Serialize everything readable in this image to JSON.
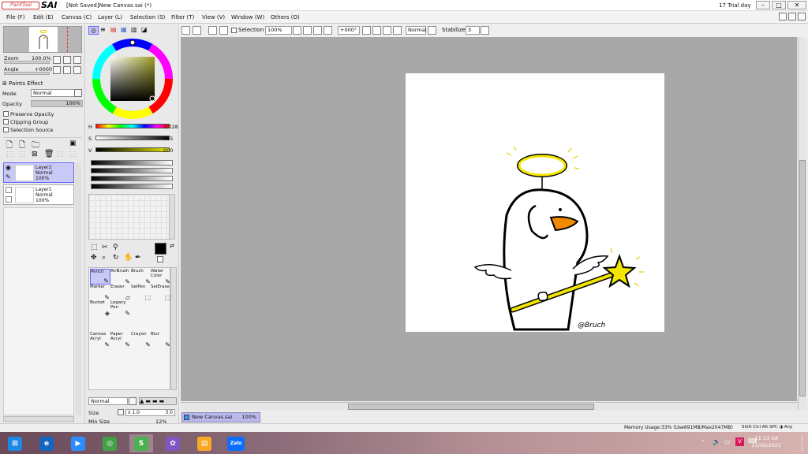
{
  "window": {
    "logo_badge": "PaintTool",
    "logo_text": "SAI",
    "doc_title": "[Not Saved]New Canvas.sai (*)",
    "trial": "17 Trial day"
  },
  "menu": [
    "File (F)",
    "Edit (E)",
    "Canvas (C)",
    "Layer (L)",
    "Selection (S)",
    "Filter (T)",
    "View (V)",
    "Window (W)",
    "Others (O)"
  ],
  "toolbar": {
    "selection_label": "Selection",
    "zoom": "100%",
    "angle": "+000°",
    "blend": "Normal",
    "stabilizer_label": "Stabilizer",
    "stabilizer_value": "3"
  },
  "navigator": {
    "zoom_label": "Zoom",
    "zoom_value": "100.0%",
    "angle_label": "Angle",
    "angle_value": "+0000"
  },
  "layer_panel": {
    "paints_effect": "Paints Effect",
    "mode_label": "Mode",
    "mode_value": "Normal",
    "opacity_label": "Opacity",
    "opacity_value": "100%",
    "preserve_opacity": "Preserve Opacity",
    "clipping_group": "Clipping Group",
    "selection_source": "Selection Source",
    "layers": [
      {
        "name": "Layer2",
        "mode": "Normal",
        "opacity": "100%",
        "selected": true
      },
      {
        "name": "Layer1",
        "mode": "Normal",
        "opacity": "100%",
        "selected": false
      }
    ]
  },
  "color": {
    "h_label": "H",
    "h_value": "1:028",
    "s_label": "S",
    "s_value": "255",
    "v_label": "V",
    "v_value": "000"
  },
  "tools": [
    {
      "name": "Pencil",
      "glyph": "✎",
      "selected": true
    },
    {
      "name": "AirBrush",
      "glyph": "✎"
    },
    {
      "name": "Brush",
      "glyph": "✎"
    },
    {
      "name": "Water Color",
      "glyph": "✎"
    },
    {
      "name": "Marker",
      "glyph": "✎"
    },
    {
      "name": "Eraser",
      "glyph": "▱"
    },
    {
      "name": "SelPen",
      "glyph": "⬚"
    },
    {
      "name": "SelErase",
      "glyph": "⬚"
    },
    {
      "name": "Bucket",
      "glyph": "◈"
    },
    {
      "name": "Legacy Pen",
      "glyph": "✎"
    },
    {
      "name": "",
      "glyph": ""
    },
    {
      "name": "",
      "glyph": ""
    },
    {
      "name": "Canvas Acryl",
      "glyph": "✎"
    },
    {
      "name": "Paper Acryl",
      "glyph": "✎"
    },
    {
      "name": "Crayon",
      "glyph": "✎"
    },
    {
      "name": "Blur",
      "glyph": "✎"
    }
  ],
  "brush": {
    "blend": "Normal",
    "size_label": "Size",
    "size_mult": "x 1.0",
    "size_value": "3.0",
    "min_size_label": "Min Size",
    "min_size_value": "12%"
  },
  "canvas": {
    "tab_label": "New Canvas.sai",
    "tab_zoom": "100%",
    "signature": "@Bruch"
  },
  "status": {
    "memory": "Memory Usage:33% (Use691MB/Max2047MB)",
    "keys": "Shift Ctrl Alt SPC ◑ Any"
  },
  "taskbar": {
    "apps": [
      {
        "name": "start",
        "glyph": "⊞",
        "color": "#1e88e5"
      },
      {
        "name": "internet-explorer",
        "glyph": "e",
        "color": "#1565c0"
      },
      {
        "name": "zoom",
        "glyph": "▶",
        "color": "#2d8cff"
      },
      {
        "name": "coccoc",
        "glyph": "◎",
        "color": "#43a047"
      },
      {
        "name": "paint-tool-sai",
        "glyph": "S",
        "color": "#4caf50"
      },
      {
        "name": "paint",
        "glyph": "✿",
        "color": "#7e57c2"
      },
      {
        "name": "file-explorer",
        "glyph": "▤",
        "color": "#f9a825"
      },
      {
        "name": "zalo",
        "glyph": "Zalo",
        "color": "#0d6efd"
      }
    ],
    "time": "11:13 SA",
    "date": "21/06/2021"
  }
}
